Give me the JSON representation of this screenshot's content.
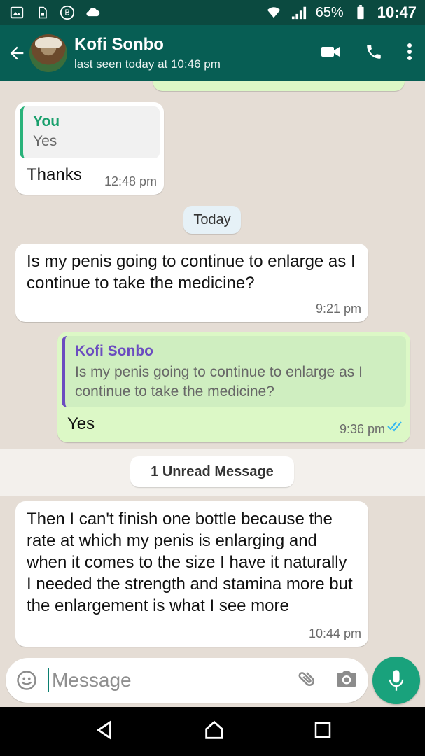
{
  "status_bar": {
    "battery_percent": "65%",
    "time": "10:47",
    "icons": [
      "gallery-icon",
      "sim-icon",
      "b-icon",
      "cloud-icon",
      "wifi-icon",
      "signal-icon",
      "battery-icon"
    ]
  },
  "header": {
    "contact_name": "Kofi Sonbo",
    "last_seen": "last seen today at 10:46 pm",
    "actions": [
      "video-call-icon",
      "call-icon",
      "more-icon"
    ]
  },
  "chat": {
    "messages": [
      {
        "direction": "in",
        "quoted": {
          "author": "You",
          "text": "Yes"
        },
        "text": "Thanks",
        "time": "12:48 pm"
      },
      {
        "date_chip": "Today"
      },
      {
        "direction": "in",
        "text": "Is my penis going to continue to enlarge as I continue to take the medicine?",
        "time": "9:21 pm"
      },
      {
        "direction": "out",
        "quoted": {
          "author": "Kofi Sonbo",
          "text": "Is my penis going to continue to enlarge as I continue to take the medicine?"
        },
        "text": "Yes",
        "time": "9:36 pm",
        "status": "read"
      },
      {
        "unread_chip": "1 Unread Message"
      },
      {
        "direction": "in",
        "text": "Then I can't finish one bottle because the rate at which my penis is enlarging and when it comes to the size I have it naturally I needed the strength and stamina more but the enlargement is what I see more",
        "time": "10:44 pm"
      }
    ]
  },
  "composer": {
    "placeholder": "Message"
  },
  "colors": {
    "header": "#075e54",
    "status_bar": "#0b4a40",
    "incoming_bubble": "#ffffff",
    "outgoing_bubble": "#dcf8c6",
    "mic_button": "#19a27c"
  }
}
